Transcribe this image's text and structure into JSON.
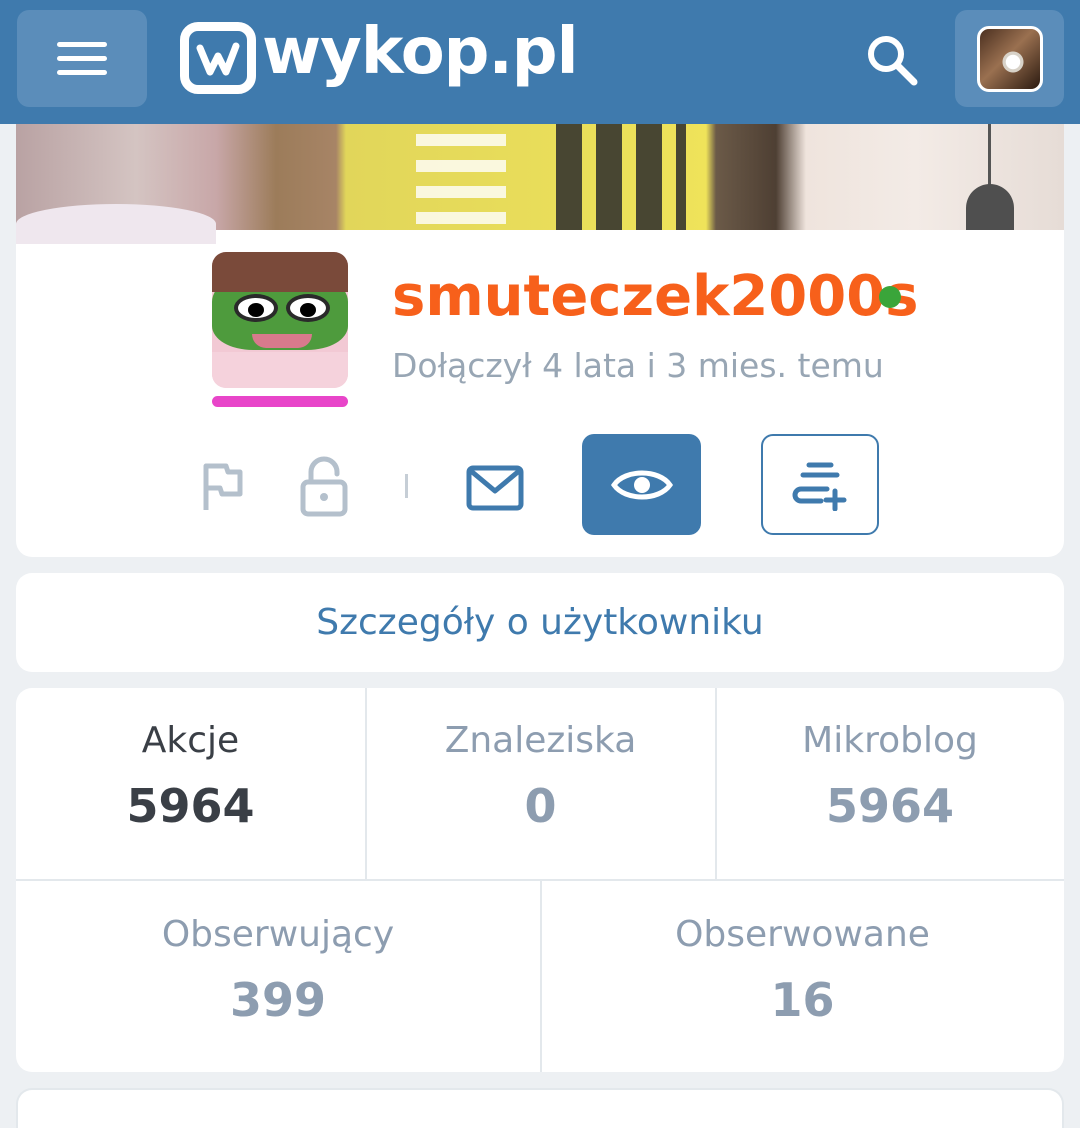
{
  "header": {
    "logo_text": "wykop.pl",
    "colors": {
      "bar": "#3f7aad",
      "button": "#5b8dba"
    }
  },
  "profile": {
    "username": "smuteczek2000s",
    "joined": "Dołączył 4 lata i 3 mies. temu",
    "online": true,
    "colors": {
      "username": "#f7601b",
      "online_dot": "#3aa53a",
      "avatar_underline": "#e845c9"
    }
  },
  "details": {
    "label": "Szczegóły o użytkowniku"
  },
  "stats": {
    "akcje": {
      "label": "Akcje",
      "value": "5964"
    },
    "znaleziska": {
      "label": "Znaleziska",
      "value": "0"
    },
    "mikroblog": {
      "label": "Mikroblog",
      "value": "5964"
    },
    "obserwujacy": {
      "label": "Obserwujący",
      "value": "399"
    },
    "obserwowane": {
      "label": "Obserwowane",
      "value": "16"
    }
  },
  "icons": [
    "menu-icon",
    "search-icon",
    "flag-icon",
    "lock-icon",
    "mail-icon",
    "eye-icon",
    "add-note-icon"
  ]
}
